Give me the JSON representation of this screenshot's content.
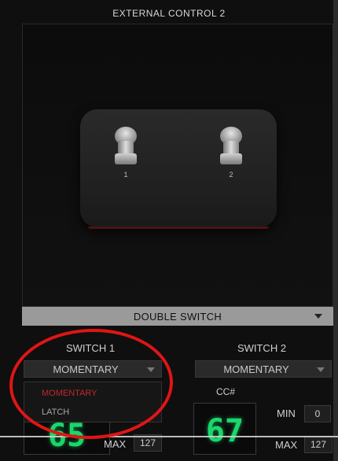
{
  "window": {
    "title": "EXTERNAL CONTROL 2"
  },
  "device": {
    "switch_numbers": [
      "1",
      "2"
    ]
  },
  "mode_selector": {
    "label": "DOUBLE SWITCH",
    "icon": "chevron-down-icon"
  },
  "switch1": {
    "title": "SWITCH 1",
    "mode_value": "MOMENTARY",
    "dropdown_options": [
      {
        "label": "MOMENTARY",
        "color": "#c0282d"
      },
      {
        "label": "LATCH",
        "color": "#a8a8a8"
      }
    ],
    "cc_value": "65",
    "max_label": "MAX",
    "max_value": "127"
  },
  "switch2": {
    "title": "SWITCH 2",
    "mode_value": "MOMENTARY",
    "cc_label": "CC#",
    "cc_value": "67",
    "min_label": "MIN",
    "min_value": "0",
    "max_label": "MAX",
    "max_value": "127"
  },
  "colors": {
    "lcd_green": "#18d86a",
    "annotation_red": "#e01515",
    "selected_option": "#c0282d"
  }
}
